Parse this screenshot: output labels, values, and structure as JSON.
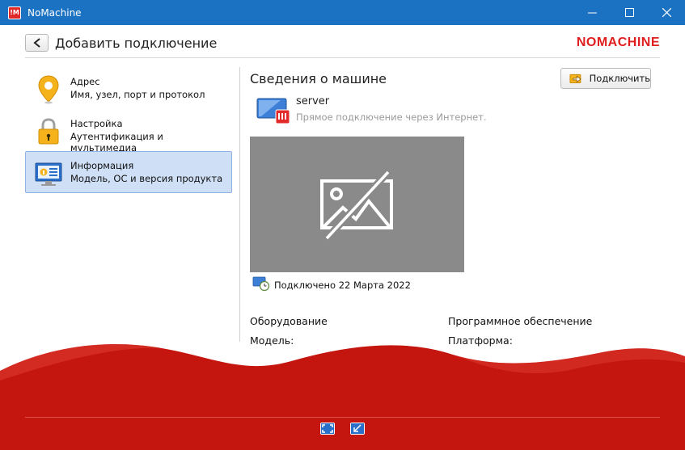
{
  "window": {
    "title": "NoMachine",
    "logo_text": "!M"
  },
  "header": {
    "back_label": "<",
    "title": "Добавить подключение",
    "brand": "NOMACHINE"
  },
  "sidebar": {
    "items": [
      {
        "title": "Адрес",
        "subtitle": "Имя, узел, порт и протокол",
        "icon": "location-pin-icon",
        "active": false
      },
      {
        "title": "Настройка",
        "subtitle": "Аутентификация и мультимедиа",
        "icon": "lock-icon",
        "active": false
      },
      {
        "title": "Информация",
        "subtitle": "Модель, ОС и версия продукта",
        "icon": "info-monitor-icon",
        "active": true
      }
    ]
  },
  "main": {
    "section_title": "Сведения о машине",
    "connect_label": "Подключить",
    "server_name": "server",
    "server_desc": "Прямое подключение через Интернет.",
    "connected_text": "Подключено 22 Марта 2022",
    "hardware_title": "Оборудование",
    "software_title": "Программное обеспечение",
    "hardware_model": "Модель:",
    "software_platform": "Платформа:"
  },
  "colors": {
    "titlebar": "#1c72c2",
    "brand": "#e01e1e",
    "wave": "#c4150f",
    "active_item": "#cfe0f6"
  }
}
